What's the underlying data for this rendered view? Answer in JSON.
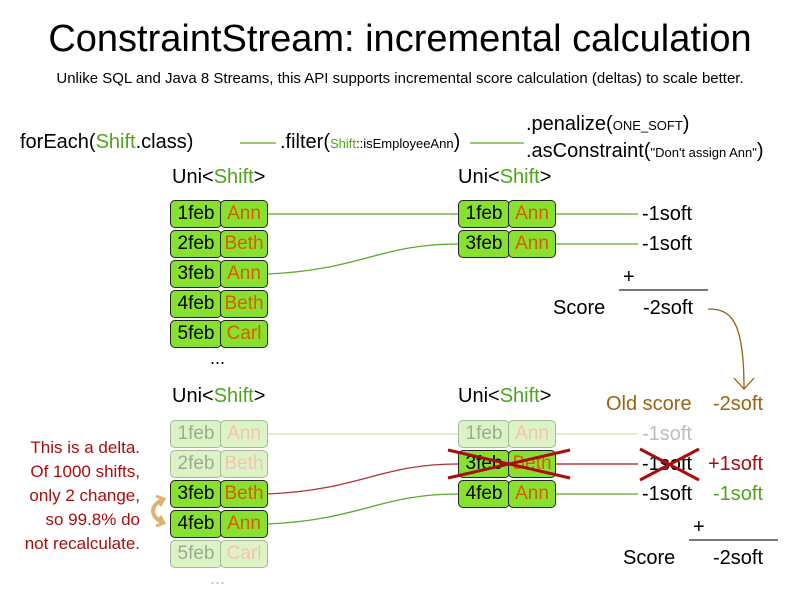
{
  "title": "ConstraintStream: incremental calculation",
  "subtitle": "Unlike SQL and Java 8 Streams, this API supports incremental score calculation (deltas) to scale better.",
  "pipeline": {
    "forEach": {
      "prefix": "forEach(",
      "class": "Shift",
      "suffix": ".class)"
    },
    "filter": {
      "prefix": ".filter(",
      "class": "Shift",
      "method": "::isEmployeeAnn",
      "suffix": ")"
    },
    "penalize": {
      "prefix": ".penalize(",
      "arg": "ONE_SOFT",
      "suffix": ")"
    },
    "asConstraint": {
      "prefix": ".asConstraint(",
      "arg": "\"Don't assign Ann\"",
      "suffix": ")"
    }
  },
  "uni_label": {
    "prefix": "Uni<",
    "type": "Shift",
    "suffix": ">"
  },
  "top": {
    "source_rows": [
      {
        "date": "1feb",
        "name": "Ann"
      },
      {
        "date": "2feb",
        "name": "Beth"
      },
      {
        "date": "3feb",
        "name": "Ann"
      },
      {
        "date": "4feb",
        "name": "Beth"
      },
      {
        "date": "5feb",
        "name": "Carl"
      }
    ],
    "ellipsis": "...",
    "filtered_rows": [
      {
        "date": "1feb",
        "name": "Ann",
        "penalty": "-1soft"
      },
      {
        "date": "3feb",
        "name": "Ann",
        "penalty": "-1soft"
      }
    ],
    "plus": "+",
    "score_label": "Score",
    "score_value": "-2soft"
  },
  "bottom": {
    "old_score_label": "Old score",
    "old_score_value": "-2soft",
    "source_rows": [
      {
        "date": "1feb",
        "name": "Ann",
        "changed": false
      },
      {
        "date": "2feb",
        "name": "Beth",
        "changed": false
      },
      {
        "date": "3feb",
        "name": "Beth",
        "changed": true
      },
      {
        "date": "4feb",
        "name": "Ann",
        "changed": true
      },
      {
        "date": "5feb",
        "name": "Carl",
        "changed": false
      }
    ],
    "ellipsis": "...",
    "filtered_rows": [
      {
        "date": "1feb",
        "name": "Ann",
        "penalty": "-1soft",
        "delta": ""
      },
      {
        "date": "3feb",
        "name": "Beth",
        "penalty": "-1soft",
        "delta": "+1soft",
        "removed": true
      },
      {
        "date": "4feb",
        "name": "Ann",
        "penalty": "-1soft",
        "delta": "-1soft"
      }
    ],
    "plus": "+",
    "score_label": "Score",
    "score_value": "-2soft",
    "delta_note": [
      "This is a delta.",
      "Of 1000 shifts,",
      "only 2 change,",
      "so 99.8% do",
      "not recalculate."
    ]
  },
  "colors": {
    "green": "#4ea41a",
    "orange": "#d65f00",
    "brown": "#9a6412",
    "red": "#a70d0d",
    "cell_fill": "#88e02f",
    "cell_fill_faded": "#dcf3c6"
  }
}
